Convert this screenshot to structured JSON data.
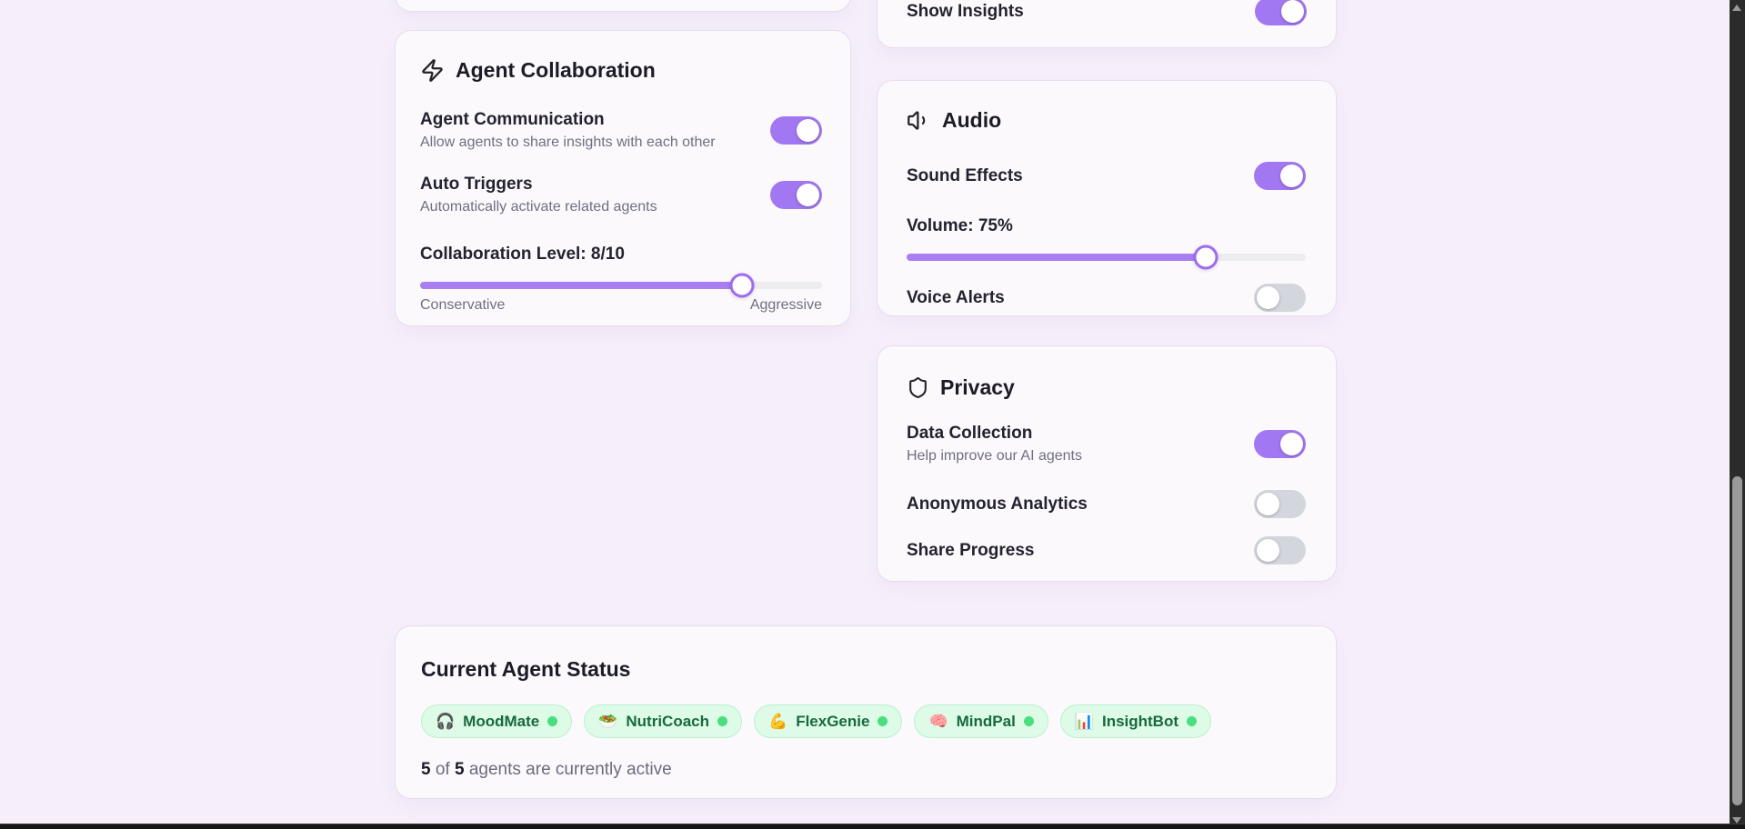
{
  "colors": {
    "accent_purple": "#a277f2",
    "slider_fill": "#a97ef2",
    "toggle_off": "#d3d6dd",
    "badge_bg": "#ddfbe7",
    "badge_text": "#176942",
    "status_dot": "#4ade80",
    "page_bg": "#f6effa",
    "card_bg": "#fcf9fd"
  },
  "cards": {
    "show_insights": {
      "label": "Show Insights",
      "on": true
    },
    "agent_collaboration": {
      "icon": "zap-icon",
      "title": "Agent Collaboration",
      "settings": [
        {
          "label": "Agent Communication",
          "description": "Allow agents to share insights with each other",
          "on": true
        },
        {
          "label": "Auto Triggers",
          "description": "Automatically activate related agents",
          "on": true
        }
      ],
      "slider": {
        "label": "Collaboration Level: 8/10",
        "value": 8,
        "max": 10,
        "min_label": "Conservative",
        "max_label": "Aggressive"
      }
    },
    "audio": {
      "icon": "speaker-icon",
      "title": "Audio",
      "sound_effects": {
        "label": "Sound Effects",
        "on": true
      },
      "volume": {
        "label": "Volume: 75%",
        "value": 75,
        "max": 100
      },
      "voice_alerts": {
        "label": "Voice Alerts",
        "on": false
      }
    },
    "privacy": {
      "icon": "shield-icon",
      "title": "Privacy",
      "toggles": [
        {
          "label": "Data Collection",
          "description": "Help improve our AI agents",
          "on": true
        },
        {
          "label": "Anonymous Analytics",
          "on": false
        },
        {
          "label": "Share Progress",
          "on": false
        }
      ]
    },
    "status": {
      "title": "Current Agent Status",
      "agents": [
        {
          "emoji": "🎧",
          "name": "MoodMate"
        },
        {
          "emoji": "🥗",
          "name": "NutriCoach"
        },
        {
          "emoji": "💪",
          "name": "FlexGenie"
        },
        {
          "emoji": "🧠",
          "name": "MindPal"
        },
        {
          "emoji": "📊",
          "name": "InsightBot"
        }
      ],
      "summary": {
        "active": "5",
        "of": "of",
        "total": "5",
        "rest": "agents are currently active"
      }
    }
  }
}
